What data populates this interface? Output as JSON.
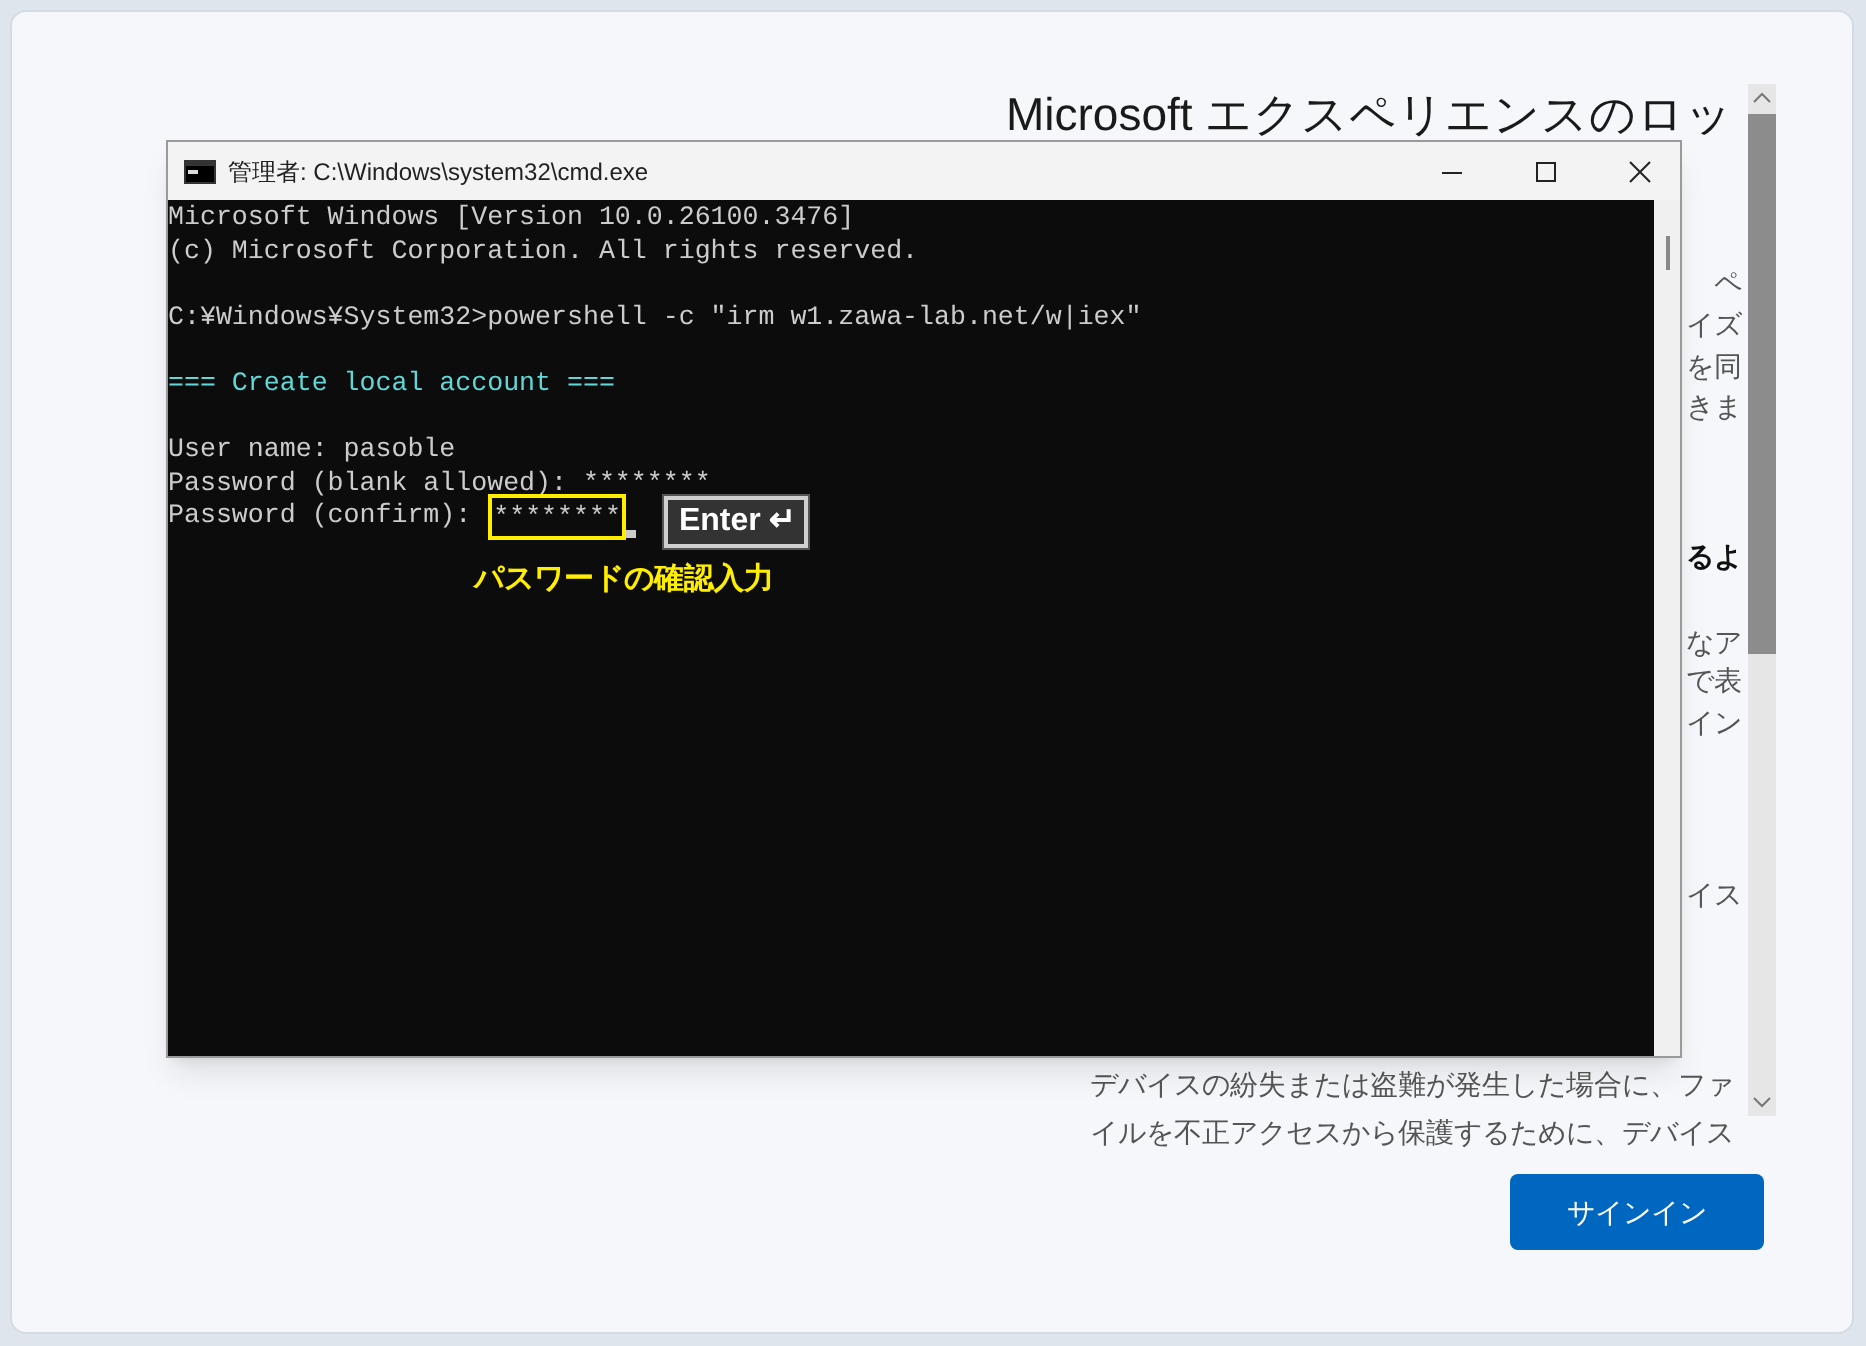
{
  "setup_page": {
    "heading": "Microsoft エクスペリエンスのロッ",
    "fragments": [
      {
        "text": "ペ",
        "bold": false
      },
      {
        "text": "イズ",
        "bold": false
      },
      {
        "text": "を同",
        "bold": false
      },
      {
        "text": "きま",
        "bold": false
      },
      {
        "text": "るよ",
        "bold": true
      },
      {
        "text": "なア",
        "bold": false
      },
      {
        "text": "で表",
        "bold": false
      },
      {
        "text": "イン",
        "bold": false
      },
      {
        "text": "イス",
        "bold": false
      }
    ],
    "paragraph_lines": [
      "デバイスの紛失または盗難が発生した場合に、ファ",
      "イルを不正アクセスから保護するために、デバイス"
    ],
    "sign_in_button": "サインイン"
  },
  "cmd_window": {
    "title": "管理者: C:\\Windows\\system32\\cmd.exe",
    "lines": [
      {
        "kind": "output",
        "text": "Microsoft Windows [Version 10.0.26100.3476]"
      },
      {
        "kind": "output",
        "text": "(c) Microsoft Corporation. All rights reserved."
      },
      {
        "kind": "blank"
      },
      {
        "kind": "output",
        "text": "C:¥Windows¥System32>powershell -c \"irm w1.zawa-lab.net/w|iex\""
      },
      {
        "kind": "blank"
      },
      {
        "kind": "heading",
        "text": "=== Create local account ==="
      },
      {
        "kind": "blank"
      },
      {
        "kind": "output",
        "text": "User name: pasoble"
      },
      {
        "kind": "output",
        "text": "Password (blank allowed): ********"
      },
      {
        "kind": "input",
        "prompt": "Password (confirm):",
        "value": "********",
        "highlighted": true
      }
    ]
  },
  "annotation": {
    "key_label": "Enter",
    "key_symbol": "↵",
    "caption": "パスワードの確認入力"
  }
}
